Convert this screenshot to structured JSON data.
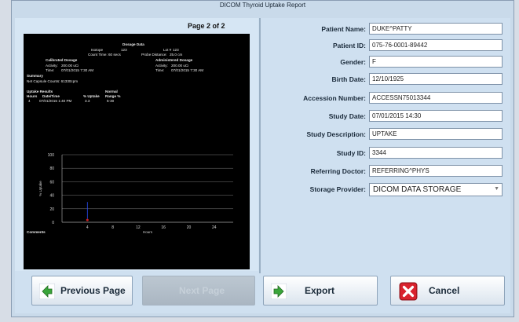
{
  "window": {
    "title_small": "",
    "title": "DICOM Thyroid Uptake Report"
  },
  "preview": {
    "page_indicator": "Page 2 of 2",
    "header_line": "",
    "dosage_title": "Dosage Data",
    "isotope_label": "Isotope",
    "isotope_value": "123",
    "lot_label": "Lot #",
    "lot_value": "123",
    "count_time_label": "Count Time:",
    "count_time_value": "60 secs",
    "probe_distance_label": "Probe Distance:",
    "probe_distance_value": "25.0 cm",
    "calibrated_title": "Calibrated Dosage",
    "administered_title": "Administered Dosage",
    "cal_activity_label": "Activity:",
    "cal_activity_value": "200.00 uCi",
    "cal_time_label": "Time:",
    "cal_time_value": "07/01/2015 7:30 AM",
    "adm_activity_label": "Activity:",
    "adm_activity_value": "200.00 uCi",
    "adm_time_label": "Time:",
    "adm_time_value": "07/01/2015 7:30 AM",
    "summary_title": "Summary",
    "net_capsule": "Net Capsule Counts: 61330cpm",
    "uptake_results_title": "Uptake Results",
    "normal_title": "Normal",
    "col_hours": "Hours",
    "col_date_time": "Date/Time",
    "col_uptake": "% Uptake",
    "col_range": "Range %",
    "row_hours": "4",
    "row_date_time": "07/01/2015 1:40 PM",
    "row_uptake": "3.3",
    "row_range": "5-30",
    "comments_label": "Comments"
  },
  "chart_data": {
    "type": "scatter",
    "x": [
      4
    ],
    "y": [
      3.3
    ],
    "xticks": [
      4,
      8,
      12,
      16,
      20,
      24
    ],
    "yticks": [
      0,
      20,
      40,
      60,
      80,
      100
    ],
    "xlim": [
      0,
      27
    ],
    "ylim": [
      0,
      100
    ],
    "xlabel": "Hours",
    "ylabel": "% Uptake",
    "normal_range": [
      5,
      30
    ],
    "grid": true,
    "colors": {
      "point": "#d02020",
      "range": "#2a50ff"
    }
  },
  "form": {
    "patient_name_label": "Patient Name:",
    "patient_name_value": "DUKE^PATTY",
    "patient_id_label": "Patient ID:",
    "patient_id_value": "075-76-0001-89442",
    "gender_label": "Gender:",
    "gender_value": "F",
    "birth_date_label": "Birth Date:",
    "birth_date_value": "12/10/1925",
    "accession_label": "Accession Number:",
    "accession_value": "ACCESSN75013344",
    "study_date_label": "Study Date:",
    "study_date_value": "07/01/2015 14:30",
    "study_desc_label": "Study Description:",
    "study_desc_value": "UPTAKE",
    "study_id_label": "Study ID:",
    "study_id_value": "3344",
    "ref_doctor_label": "Referring Doctor:",
    "ref_doctor_value": "REFERRING^PHYS",
    "storage_label": "Storage Provider:",
    "storage_value": "DICOM DATA STORAGE"
  },
  "buttons": {
    "previous": "Previous Page",
    "next": "Next Page",
    "export": "Export",
    "cancel": "Cancel"
  },
  "colors": {
    "window_bg": "#c9daea",
    "accent_green": "#3aa53a",
    "cancel_red": "#d9232e"
  }
}
